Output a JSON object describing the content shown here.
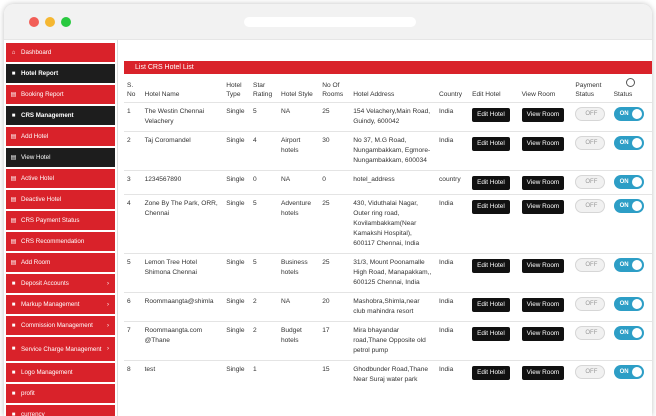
{
  "sidebar": {
    "items": [
      {
        "label": "Dashboard",
        "icon": "house-icon",
        "style": "red"
      },
      {
        "label": "Hotel Report",
        "icon": "lock-icon",
        "style": "dark"
      },
      {
        "label": "Booking Report",
        "icon": "file-icon",
        "style": "red"
      },
      {
        "label": "CRS Management",
        "icon": "lock-icon",
        "style": "dark"
      },
      {
        "label": "Add Hotel",
        "icon": "file-icon",
        "style": "red"
      },
      {
        "label": "View Hotel",
        "icon": "file-icon",
        "style": "dark-plain"
      },
      {
        "label": "Active Hotel",
        "icon": "file-icon",
        "style": "red"
      },
      {
        "label": "Deactive Hotel",
        "icon": "file-icon",
        "style": "red"
      },
      {
        "label": "CRS Payment Status",
        "icon": "file-icon",
        "style": "red"
      },
      {
        "label": "CRS Recommendation",
        "icon": "file-icon",
        "style": "red"
      },
      {
        "label": "Add Room",
        "icon": "file-icon",
        "style": "red"
      },
      {
        "label": "Deposit Accounts",
        "icon": "lock-icon",
        "style": "red",
        "arrow": "›"
      },
      {
        "label": "Markup Management",
        "icon": "lock-icon",
        "style": "red",
        "arrow": "›"
      },
      {
        "label": "Commission Management",
        "icon": "lock-icon",
        "style": "red",
        "arrow": "›"
      },
      {
        "label": "Service Charge Management",
        "icon": "lock-icon",
        "style": "red",
        "arrow": "›"
      },
      {
        "label": "Logo Management",
        "icon": "lock-icon",
        "style": "red"
      },
      {
        "label": "profit",
        "icon": "lock-icon",
        "style": "red"
      },
      {
        "label": "currency",
        "icon": "lock-icon",
        "style": "red"
      }
    ]
  },
  "panel": {
    "title": "List CRS Hotel List"
  },
  "table": {
    "headers": [
      "S. No",
      "Hotel Name",
      "Hotel Type",
      "Star Rating",
      "Hotel Style",
      "No Of Rooms",
      "Hotel Address",
      "Country",
      "Edit Hotel",
      "View Room",
      "Payment Status",
      "Status"
    ],
    "edit_label": "Edit Hotel",
    "view_label": "View Room",
    "off_label": "OFF",
    "on_label": "ON",
    "rows": [
      [
        "1",
        "The Westin Chennai Velachery",
        "Single",
        "5",
        "NA",
        "25",
        "154 Velachery,Main Road, Guindy, 600042",
        "India"
      ],
      [
        "2",
        "Taj Coromandel",
        "Single",
        "4",
        "Airport hotels",
        "30",
        "No 37, M.G Road, Nungambakkam, Egmore-Nungambakkam, 600034",
        "India"
      ],
      [
        "3",
        "1234567890",
        "Single",
        "0",
        "NA",
        "0",
        "hotel_address",
        "country"
      ],
      [
        "4",
        "Zone By The Park, ORR, Chennai",
        "Single",
        "5",
        "Adventure hotels",
        "25",
        "430, Viduthalai Nagar, Outer ring road, Kovilambakkam(Near Kamakshi Hospital), 600117 Chennai, India",
        "India"
      ],
      [
        "5",
        "Lemon Tree Hotel Shimona Chennai",
        "Single",
        "5",
        "Business hotels",
        "25",
        "31/3, Mount Poonamalle High Road, Manapakkam,, 600125 Chennai, India",
        "India"
      ],
      [
        "6",
        "Roommaangta@shimla",
        "Single",
        "2",
        "NA",
        "20",
        "Mashobra,Shimla,near club mahindra resort",
        "India"
      ],
      [
        "7",
        "Roommaangta.com @Thane",
        "Single",
        "2",
        "Budget hotels",
        "17",
        "Mira bhayandar road,Thane Opposite old petrol pump",
        "India"
      ],
      [
        "8",
        "test",
        "Single",
        "1",
        "",
        "15",
        "Ghodbunder Road,Thane Near Suraj water park",
        "India"
      ]
    ]
  }
}
